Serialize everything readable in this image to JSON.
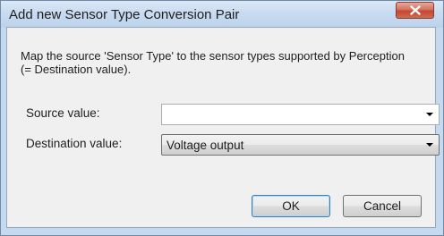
{
  "dialog": {
    "title": "Add new Sensor Type Conversion Pair",
    "description": "Map the source 'Sensor Type' to the sensor types supported by Perception  (= Destination value)."
  },
  "fields": {
    "source": {
      "label": "Source value:",
      "value": ""
    },
    "destination": {
      "label": "Destination value:",
      "value": "Voltage output"
    }
  },
  "buttons": {
    "ok_label": "OK",
    "cancel_label": "Cancel"
  },
  "icons": {
    "close": "close-icon",
    "dropdown": "chevron-down-icon"
  },
  "colors": {
    "close_button": "#c9503a",
    "title_bar": "#c5d9ef",
    "client_bg": "#f0f0f0"
  }
}
